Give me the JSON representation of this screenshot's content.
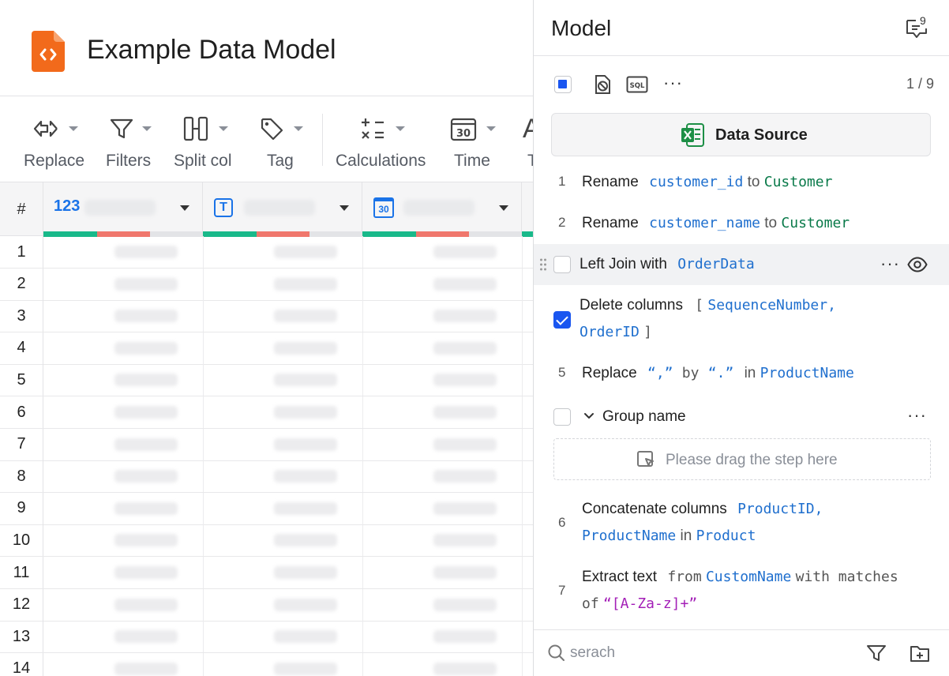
{
  "app": {
    "title": "Example Data Model"
  },
  "toolbar": {
    "items": [
      {
        "label": "Replace",
        "icon": "replace-icon"
      },
      {
        "label": "Filters",
        "icon": "filter-icon"
      },
      {
        "label": "Split col",
        "icon": "split-column-icon"
      },
      {
        "label": "Tag",
        "icon": "tag-icon"
      },
      {
        "label": "Calculations",
        "icon": "calculations-icon"
      },
      {
        "label": "Time",
        "icon": "calendar-icon"
      },
      {
        "label": "T",
        "icon": "text-icon"
      }
    ]
  },
  "grid": {
    "index_header": "#",
    "columns": [
      {
        "type_label": "123",
        "type": "number"
      },
      {
        "type_label": "T",
        "type": "text"
      },
      {
        "type_label": "30",
        "type": "date"
      },
      {
        "type_label": "",
        "type": "unknown"
      }
    ],
    "quality_colors": {
      "valid": "#19b98a",
      "invalid": "#f0776d",
      "empty": "#e3e4e7"
    },
    "row_numbers": [
      "1",
      "2",
      "3",
      "4",
      "5",
      "6",
      "7",
      "8",
      "9",
      "10",
      "11",
      "12",
      "13",
      "14"
    ]
  },
  "panel": {
    "title": "Model",
    "comment_count": "9",
    "counter": "1 / 9",
    "data_source_label": "Data Source",
    "steps": [
      {
        "num": "1",
        "action": "Rename",
        "from": "customer_id",
        "to_word": "to",
        "to": "Customer"
      },
      {
        "num": "2",
        "action": "Rename",
        "from": "customer_name",
        "to_word": "to",
        "to": "Customer"
      },
      {
        "action": "Left Join with",
        "target": "OrderData"
      },
      {
        "action": "Delete columns",
        "open": "[",
        "col1": "SequenceNumber,",
        "col2": "OrderID",
        "close": "]"
      },
      {
        "num": "5",
        "action": "Replace",
        "find": "“,”",
        "by": "by",
        "repl": "“.”",
        "in_word": "in",
        "target": "ProductName"
      },
      {
        "group_name": "Group name",
        "drop_text": "Please drag the step here"
      },
      {
        "num": "6",
        "action": "Concatenate columns",
        "col1": "ProductID,",
        "col2": "ProductName",
        "in_word": "in",
        "target": "Product"
      },
      {
        "num": "7",
        "action": "Extract text",
        "from_word": "from",
        "source": "CustomName",
        "with_word": "with matches",
        "of_word": "of",
        "pattern": "“[A-Za-z]+”"
      }
    ],
    "search": {
      "placeholder": "serach",
      "value": ""
    }
  },
  "colors": {
    "accent": "#1a56f0",
    "file_icon": "#f26a1b",
    "excel": "#1d8f46"
  }
}
